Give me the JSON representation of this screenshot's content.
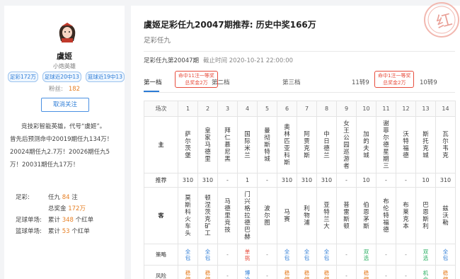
{
  "profile": {
    "name": "虞姬",
    "title": "小炮英雄",
    "badges": [
      "足彩172万",
      "足球近20中13",
      "篮球近19中13"
    ],
    "fans_label": "粉丝:",
    "fans_count": "182",
    "unfollow_label": "取消关注",
    "intro": [
      "竞技彩智能英雄，代号“虞姬”。",
      "曾先后预测命中20019期任九134万！",
      "20024期任九2.7万！20026期任九5",
      "万！20031期任九17万！"
    ],
    "stats": {
      "lottery_label": "足彩:",
      "lottery_line1_pre": "任九",
      "lottery_line1_val": "84",
      "lottery_line1_post": "注",
      "lottery_line2_pre": "总奖金",
      "lottery_line2_val": "172万",
      "football_label": "足球单场:",
      "football_pre": "累计",
      "football_val": "348",
      "football_post": "个红单",
      "basketball_label": "篮球单场:",
      "basketball_pre": "累计",
      "basketball_val": "53",
      "basketball_post": "个红单"
    }
  },
  "article": {
    "title": "虞姬足彩任九20047期推荐: 历史中奖166万",
    "subtitle": "足彩任九",
    "stamp_text": "红",
    "meta_issue": "足彩任九第20047期",
    "meta_time": "截止时间  2020-10-21 22:00:00"
  },
  "tabs": {
    "items": [
      "第一档",
      "第二档",
      "第三档",
      "11转9",
      "10转9"
    ],
    "bubble1_line1": "命中11注一等奖",
    "bubble1_line2": "总奖金2万",
    "bubble2_line1": "命中1注一等奖",
    "bubble2_line2": "总奖金2万"
  },
  "table": {
    "header_label": "场次",
    "row_labels": {
      "home": "主",
      "pick": "推荐",
      "away": "客",
      "strategy": "策略",
      "risk": "风险"
    },
    "matches": [
      {
        "no": "1",
        "home": "萨尔茨堡",
        "pick": "310",
        "away": "莫斯科火车头",
        "strategy": "全包",
        "risk": "稳健"
      },
      {
        "no": "2",
        "home": "皇家马德里",
        "pick": "310",
        "away": "顿涅茨克矿工",
        "strategy": "全包",
        "risk": "稳健"
      },
      {
        "no": "3",
        "home": "拜仁慕尼黑",
        "pick": "-",
        "away": "马德里竞技",
        "strategy": "-",
        "risk": "-"
      },
      {
        "no": "4",
        "home": "国际米兰",
        "pick": "1",
        "away": "门兴格拉德巴赫",
        "strategy": "单挑",
        "risk": "博冷"
      },
      {
        "no": "5",
        "home": "曼彻斯特城",
        "pick": "-",
        "away": "波尔图",
        "strategy": "-",
        "risk": "-"
      },
      {
        "no": "6",
        "home": "奥林匹亚科斯",
        "pick": "310",
        "away": "马赛",
        "strategy": "全包",
        "risk": "稳健"
      },
      {
        "no": "7",
        "home": "阿贾克斯",
        "pick": "310",
        "away": "利物浦",
        "strategy": "全包",
        "risk": "稳健"
      },
      {
        "no": "8",
        "home": "中日德兰",
        "pick": "310",
        "away": "亚特兰大",
        "strategy": "全包",
        "risk": "稳健"
      },
      {
        "no": "9",
        "home": "女王公园巡游者",
        "pick": "-",
        "away": "普雷斯顿",
        "strategy": "-",
        "risk": "-"
      },
      {
        "no": "10",
        "home": "加的夫城",
        "pick": "10",
        "away": "伯恩茅斯",
        "strategy": "双选",
        "risk": "稳健"
      },
      {
        "no": "11",
        "home": "谢菲尔德星期三",
        "pick": "-",
        "away": "布伦特福德",
        "strategy": "-",
        "risk": "-"
      },
      {
        "no": "12",
        "home": "沃特福德",
        "pick": "-",
        "away": "布莱克本",
        "strategy": "-",
        "risk": "-"
      },
      {
        "no": "13",
        "home": "斯托克城",
        "pick": "10",
        "away": "巴恩斯利",
        "strategy": "双选",
        "risk": "机会"
      },
      {
        "no": "14",
        "home": "瓦尔韦克",
        "pick": "310",
        "away": "兹沃勒",
        "strategy": "全包",
        "risk": "稳健"
      }
    ]
  },
  "colors": {
    "accent": "#2b7bd6",
    "red": "#e74c3c",
    "orange": "#e67e22",
    "green": "#27ae60"
  }
}
